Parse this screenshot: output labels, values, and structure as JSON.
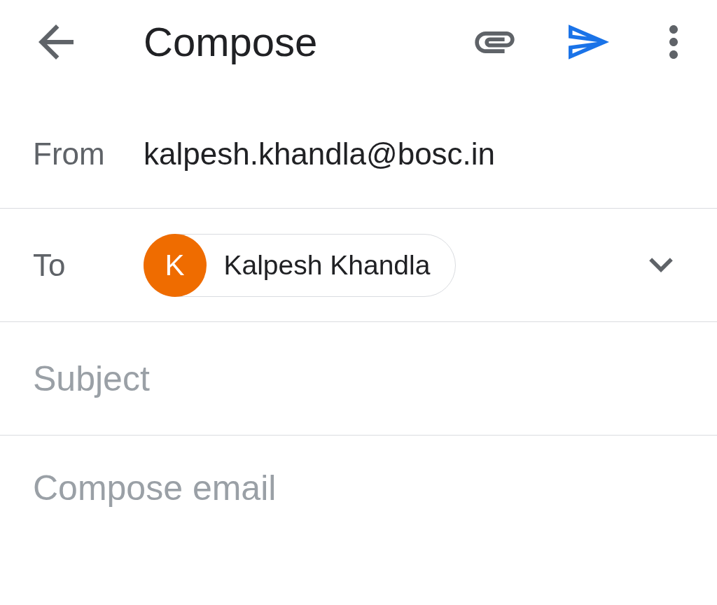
{
  "toolbar": {
    "title": "Compose"
  },
  "from": {
    "label": "From",
    "value": "kalpesh.khandla@bosc.in"
  },
  "to": {
    "label": "To",
    "recipients": [
      {
        "initial": "K",
        "name": "Kalpesh Khandla",
        "color": "#ef6c00"
      }
    ]
  },
  "subject": {
    "placeholder": "Subject"
  },
  "body": {
    "placeholder": "Compose email"
  }
}
